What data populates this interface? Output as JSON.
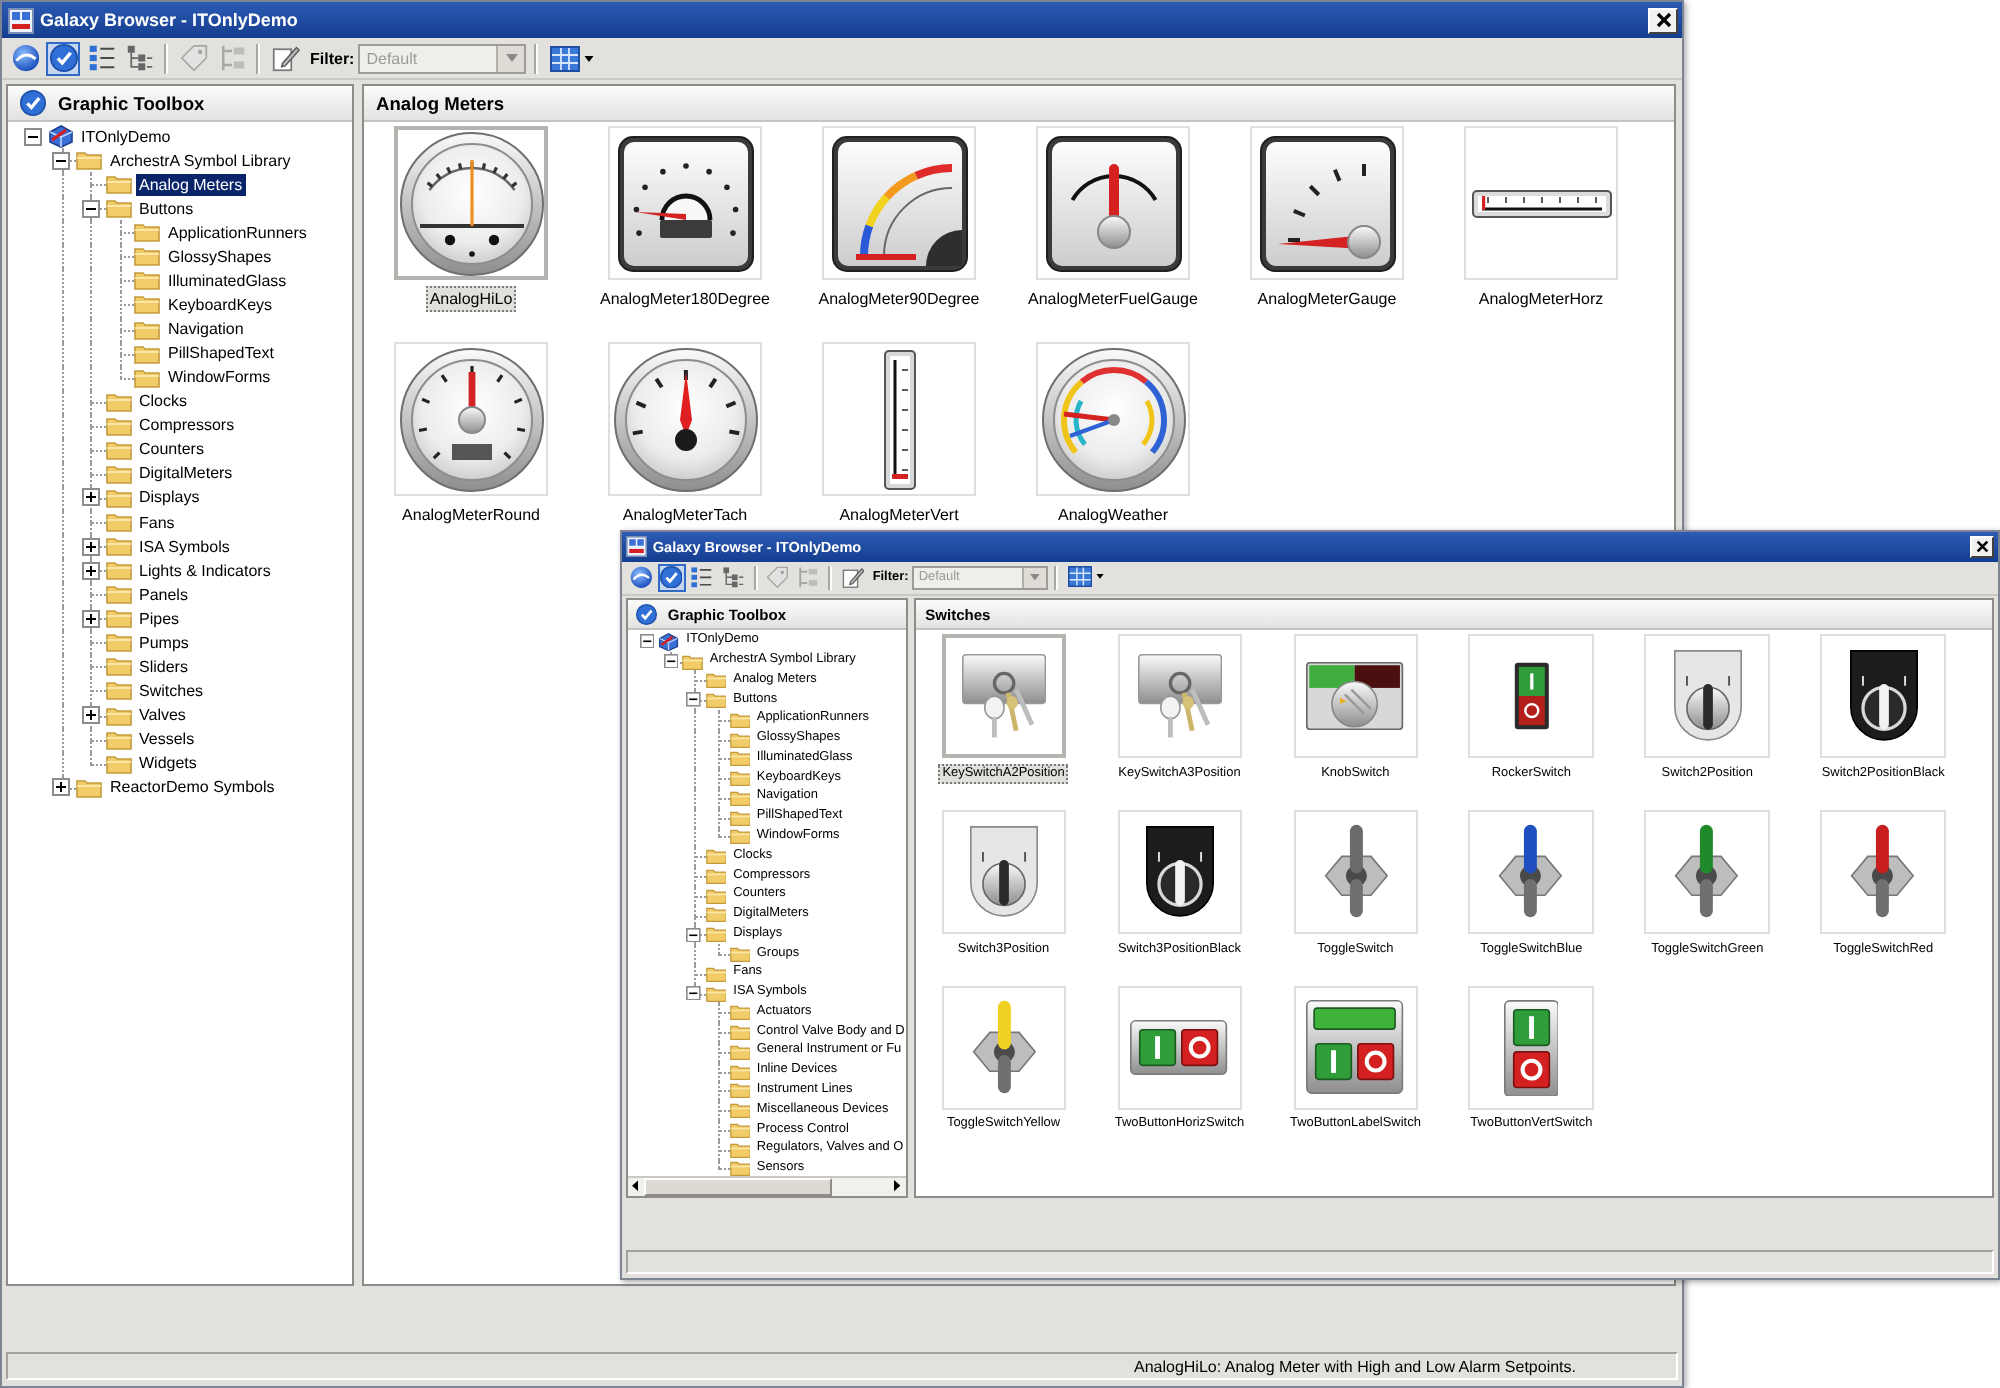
{
  "windows": [
    {
      "title": "Galaxy Browser - ITOnlyDemo",
      "toolbar": {
        "buttons": [
          {
            "kind": "sphere",
            "pressed": false,
            "disabled": false
          },
          {
            "kind": "check",
            "pressed": true,
            "disabled": false
          },
          {
            "kind": "list",
            "pressed": false,
            "disabled": false
          },
          {
            "kind": "hierarchy",
            "pressed": false,
            "disabled": false
          },
          {
            "kind": "tag",
            "pressed": false,
            "disabled": true
          },
          {
            "kind": "tree",
            "pressed": false,
            "disabled": true
          },
          {
            "kind": "pencil",
            "pressed": false,
            "disabled": false
          }
        ],
        "filter": {
          "label": "Filter:",
          "value": "Default",
          "disabled": true
        }
      },
      "toolbox": {
        "title": "Graphic Toolbox",
        "tree": [
          {
            "label": "ITOnlyDemo",
            "expanded": true,
            "selected": false,
            "children": [
              {
                "label": "ArchestrA Symbol Library",
                "expanded": true,
                "selected": false,
                "children": [
                  {
                    "label": "Analog Meters",
                    "selected": true
                  },
                  {
                    "label": "Buttons",
                    "expanded": true,
                    "selected": false,
                    "children": [
                      {
                        "label": "ApplicationRunners",
                        "selected": false
                      },
                      {
                        "label": "GlossyShapes",
                        "selected": false
                      },
                      {
                        "label": "IlluminatedGlass",
                        "selected": false
                      },
                      {
                        "label": "KeyboardKeys",
                        "selected": false
                      },
                      {
                        "label": "Navigation",
                        "selected": false
                      },
                      {
                        "label": "PillShapedText",
                        "selected": false
                      },
                      {
                        "label": "WindowForms",
                        "selected": false
                      }
                    ]
                  },
                  {
                    "label": "Clocks",
                    "selected": false
                  },
                  {
                    "label": "Compressors",
                    "selected": false
                  },
                  {
                    "label": "Counters",
                    "selected": false
                  },
                  {
                    "label": "DigitalMeters",
                    "selected": false
                  },
                  {
                    "label": "Displays",
                    "expanded": false,
                    "selected": false
                  },
                  {
                    "label": "Fans",
                    "selected": false
                  },
                  {
                    "label": "ISA Symbols",
                    "expanded": false,
                    "selected": false
                  },
                  {
                    "label": "Lights & Indicators",
                    "expanded": false,
                    "selected": false
                  },
                  {
                    "label": "Panels",
                    "selected": false
                  },
                  {
                    "label": "Pipes",
                    "expanded": false,
                    "selected": false
                  },
                  {
                    "label": "Pumps",
                    "selected": false
                  },
                  {
                    "label": "Sliders",
                    "selected": false
                  },
                  {
                    "label": "Switches",
                    "selected": false
                  },
                  {
                    "label": "Valves",
                    "expanded": false,
                    "selected": false
                  },
                  {
                    "label": "Vessels",
                    "selected": false
                  },
                  {
                    "label": "Widgets",
                    "selected": false
                  }
                ]
              },
              {
                "label": "ReactorDemo Symbols",
                "expanded": false,
                "selected": false
              }
            ]
          }
        ]
      },
      "content": {
        "title": "Analog Meters",
        "symbols": [
          {
            "name": "AnalogHiLo",
            "kind": "hilo",
            "selected": true
          },
          {
            "name": "AnalogMeter180Degree",
            "kind": "meter180",
            "selected": false
          },
          {
            "name": "AnalogMeter90Degree",
            "kind": "meter90",
            "selected": false
          },
          {
            "name": "AnalogMeterFuelGauge",
            "kind": "fuel",
            "selected": false
          },
          {
            "name": "AnalogMeterGauge",
            "kind": "gauge",
            "selected": false
          },
          {
            "name": "AnalogMeterHorz",
            "kind": "horizontal",
            "selected": false
          },
          {
            "name": "AnalogMeterRound",
            "kind": "round",
            "selected": false
          },
          {
            "name": "AnalogMeterTach",
            "kind": "tach",
            "selected": false
          },
          {
            "name": "AnalogMeterVert",
            "kind": "vertical",
            "selected": false
          },
          {
            "name": "AnalogWeather",
            "kind": "weather",
            "selected": false
          }
        ]
      },
      "status_bar": {
        "text": "AnalogHiLo: Analog Meter with High and Low Alarm Setpoints."
      }
    },
    {
      "title": "Galaxy Browser - ITOnlyDemo",
      "toolbar": {
        "buttons": [
          {
            "kind": "sphere",
            "pressed": false,
            "disabled": false
          },
          {
            "kind": "check",
            "pressed": true,
            "disabled": false
          },
          {
            "kind": "list",
            "pressed": false,
            "disabled": false
          },
          {
            "kind": "hierarchy",
            "pressed": false,
            "disabled": false
          },
          {
            "kind": "tag",
            "pressed": false,
            "disabled": true
          },
          {
            "kind": "tree",
            "pressed": false,
            "disabled": true
          },
          {
            "kind": "pencil",
            "pressed": false,
            "disabled": false
          }
        ],
        "filter": {
          "label": "Filter:",
          "value": "Default",
          "disabled": true
        }
      },
      "toolbox": {
        "title": "Graphic Toolbox",
        "tree": [
          {
            "label": "ITOnlyDemo",
            "expanded": true,
            "selected": false,
            "children": [
              {
                "label": "ArchestrA Symbol Library",
                "expanded": true,
                "selected": false,
                "children": [
                  {
                    "label": "Analog Meters",
                    "selected": false
                  },
                  {
                    "label": "Buttons",
                    "expanded": true,
                    "selected": false,
                    "children": [
                      {
                        "label": "ApplicationRunners",
                        "selected": false
                      },
                      {
                        "label": "GlossyShapes",
                        "selected": false
                      },
                      {
                        "label": "IlluminatedGlass",
                        "selected": false
                      },
                      {
                        "label": "KeyboardKeys",
                        "selected": false
                      },
                      {
                        "label": "Navigation",
                        "selected": false
                      },
                      {
                        "label": "PillShapedText",
                        "selected": false
                      },
                      {
                        "label": "WindowForms",
                        "selected": false
                      }
                    ]
                  },
                  {
                    "label": "Clocks",
                    "selected": false
                  },
                  {
                    "label": "Compressors",
                    "selected": false
                  },
                  {
                    "label": "Counters",
                    "selected": false
                  },
                  {
                    "label": "DigitalMeters",
                    "selected": false
                  },
                  {
                    "label": "Displays",
                    "expanded": true,
                    "selected": false,
                    "children": [
                      {
                        "label": "Groups",
                        "selected": false
                      }
                    ]
                  },
                  {
                    "label": "Fans",
                    "selected": false
                  },
                  {
                    "label": "ISA Symbols",
                    "expanded": true,
                    "selected": false,
                    "children": [
                      {
                        "label": "Actuators",
                        "selected": false
                      },
                      {
                        "label": "Control Valve Body and D",
                        "selected": false
                      },
                      {
                        "label": "General Instrument or Fu",
                        "selected": false
                      },
                      {
                        "label": "Inline Devices",
                        "selected": false
                      },
                      {
                        "label": "Instrument Lines",
                        "selected": false
                      },
                      {
                        "label": "Miscellaneous Devices",
                        "selected": false
                      },
                      {
                        "label": "Process Control",
                        "selected": false
                      },
                      {
                        "label": "Regulators, Valves and O",
                        "selected": false
                      },
                      {
                        "label": "Sensors",
                        "selected": false
                      }
                    ]
                  }
                ]
              }
            ]
          }
        ]
      },
      "content": {
        "title": "Switches",
        "symbols": [
          {
            "name": "KeySwitchA2Position",
            "kind": "key",
            "selected": true
          },
          {
            "name": "KeySwitchA3Position",
            "kind": "key",
            "selected": false
          },
          {
            "name": "KnobSwitch",
            "kind": "knob",
            "selected": false
          },
          {
            "name": "RockerSwitch",
            "kind": "rocker",
            "selected": false
          },
          {
            "name": "Switch2Position",
            "kind": "selector",
            "selected": false
          },
          {
            "name": "Switch2PositionBlack",
            "kind": "blackselector",
            "selected": false
          },
          {
            "name": "Switch3Position",
            "kind": "selector",
            "selected": false
          },
          {
            "name": "Switch3PositionBlack",
            "kind": "blackselector",
            "selected": false
          },
          {
            "name": "ToggleSwitch",
            "kind": "toggle",
            "color": "#6b6b6b",
            "selected": false
          },
          {
            "name": "ToggleSwitchBlue",
            "kind": "toggle",
            "color": "#1f4fbf",
            "selected": false
          },
          {
            "name": "ToggleSwitchGreen",
            "kind": "toggle",
            "color": "#1f8a2a",
            "selected": false
          },
          {
            "name": "ToggleSwitchRed",
            "kind": "toggle",
            "color": "#c81e1e",
            "selected": false
          },
          {
            "name": "ToggleSwitchYellow",
            "kind": "toggle",
            "color": "#f0d020",
            "selected": false
          },
          {
            "name": "TwoButtonHorizSwitch",
            "kind": "twohoriz",
            "selected": false
          },
          {
            "name": "TwoButtonLabelSwitch",
            "kind": "twolabel",
            "selected": false
          },
          {
            "name": "TwoButtonVertSwitch",
            "kind": "twovert",
            "selected": false
          }
        ]
      }
    }
  ]
}
